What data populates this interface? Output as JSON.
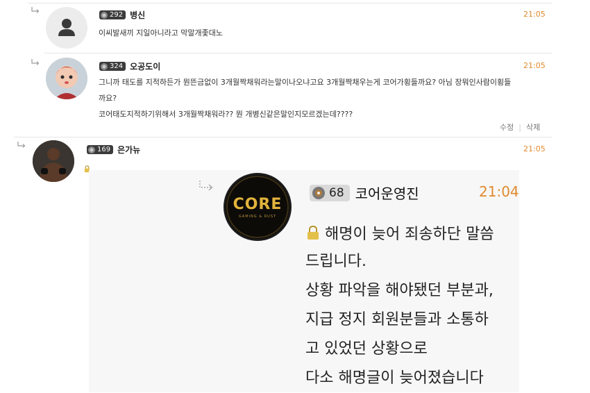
{
  "comments": [
    {
      "level": "292",
      "nickname": "병신",
      "time": "21:05",
      "text": "이씨발새끼 지일아니라고 막말개좇대노"
    },
    {
      "level": "324",
      "nickname": "오공도이",
      "time": "21:05",
      "lines": [
        "그니까 태도를 지적하든가 뭔뜬금없이 3개월짝채워라는말이나오냐고요 3개월짝채우는게 코어가횡들까요? 아님 장뭐인사람이횡들",
        "까요?",
        "코어태도지적하기위해서 3개월짝채워라?? 뭔 개병신같은말인지모르겠는데????"
      ],
      "edit_label": "수정",
      "separator": "|",
      "delete_label": "삭제"
    },
    {
      "level": "169",
      "nickname": "은가뉴",
      "time": "21:05"
    }
  ],
  "embedded": {
    "level": "68",
    "nickname": "코어운영진",
    "time": "21:04",
    "logo_text": "CORE",
    "logo_sub": "GAMING & RUST",
    "lines": [
      "해명이 늦어 죄송하단 말씀",
      "드립니다.",
      "상황 파악을 해야됐던 부분과,",
      "지급 정지 회원분들과 소통하",
      "고 있었던 상황으로",
      "다소 해명글이 늦어졌습니다"
    ]
  },
  "icons": {
    "reply": "reply-arrow-icon",
    "level": "level-badge-icon",
    "lock": "lock-icon",
    "default_avatar": "user-silhouette-icon"
  },
  "colors": {
    "time": "#e08a2e",
    "badge": "#3b3b3b",
    "divider": "#e6e6e6"
  }
}
